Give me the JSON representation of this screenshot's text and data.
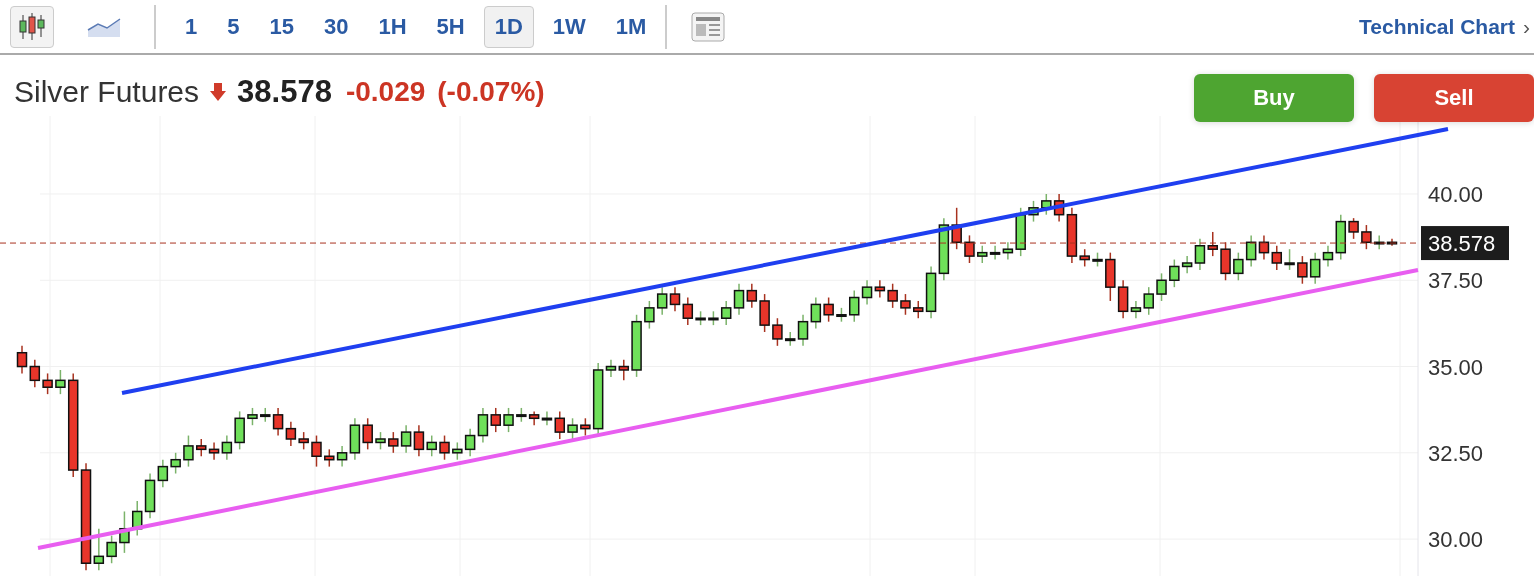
{
  "toolbar": {
    "chart_types": [
      {
        "kind": "candlestick",
        "selected": true
      },
      {
        "kind": "area",
        "selected": false
      }
    ],
    "intervals": [
      {
        "label": "1",
        "selected": false
      },
      {
        "label": "5",
        "selected": false
      },
      {
        "label": "15",
        "selected": false
      },
      {
        "label": "30",
        "selected": false
      },
      {
        "label": "1H",
        "selected": false
      },
      {
        "label": "5H",
        "selected": false
      },
      {
        "label": "1D",
        "selected": true
      },
      {
        "label": "1W",
        "selected": false
      },
      {
        "label": "1M",
        "selected": false
      }
    ],
    "link": {
      "label": "Technical Chart",
      "chevron": "›"
    }
  },
  "quote": {
    "name": "Silver Futures",
    "falling": true,
    "price": "38.578",
    "change": "-0.029",
    "change_percent": "(-0.07%)"
  },
  "actions": [
    {
      "kind": "buy",
      "label": "Buy"
    },
    {
      "kind": "sell",
      "label": "Sell"
    }
  ],
  "chart": {
    "chart_data": {
      "type": "candlestick",
      "grid": true,
      "ylim": [
        28.93,
        42.26
      ],
      "ref_lines": [
        {
          "axis": "y",
          "value": 38.578,
          "label": "38.578"
        }
      ],
      "yticks": [
        {
          "value": 40,
          "label": "40.00"
        },
        {
          "value": 37.5,
          "label": "37.50"
        },
        {
          "value": 35,
          "label": "35.00"
        },
        {
          "value": 32.5,
          "label": "32.50"
        },
        {
          "value": 30,
          "label": "30.00"
        }
      ],
      "categories": [
        null,
        null,
        null,
        null,
        null,
        null,
        null,
        null,
        null,
        null,
        null,
        null,
        null,
        null,
        null,
        null,
        null,
        null,
        null,
        null,
        null,
        null,
        null,
        null,
        null,
        null,
        null,
        null,
        null,
        null,
        null,
        null,
        null,
        null,
        null,
        null,
        null,
        null,
        null,
        null,
        null,
        null,
        null,
        null,
        null,
        null,
        null,
        null,
        null,
        null,
        null,
        null,
        null,
        null,
        null,
        null,
        null,
        null,
        null,
        null,
        null,
        null,
        null,
        null,
        null,
        null,
        null,
        null,
        null,
        null,
        null,
        null,
        null,
        null,
        null,
        null,
        null,
        null,
        null,
        null,
        null,
        null,
        null,
        null,
        null,
        null,
        null,
        null,
        null,
        null,
        null,
        null,
        null,
        null,
        null,
        null,
        null,
        null,
        null,
        null,
        null,
        null,
        null,
        null,
        null,
        null,
        null,
        null
      ],
      "ohlc": [
        [
          35.4,
          35.6,
          34.8,
          35.0
        ],
        [
          35.0,
          35.2,
          34.4,
          34.6
        ],
        [
          34.6,
          34.8,
          34.2,
          34.4
        ],
        [
          34.4,
          34.9,
          34.2,
          34.6
        ],
        [
          34.6,
          34.8,
          31.8,
          32.0
        ],
        [
          32.0,
          32.2,
          29.1,
          29.3
        ],
        [
          29.3,
          30.3,
          29.1,
          29.5
        ],
        [
          29.5,
          30.1,
          29.3,
          29.9
        ],
        [
          29.9,
          30.8,
          29.6,
          30.3
        ],
        [
          30.3,
          31.1,
          30.1,
          30.8
        ],
        [
          30.8,
          31.9,
          30.6,
          31.7
        ],
        [
          31.7,
          32.3,
          31.5,
          32.1
        ],
        [
          32.1,
          32.5,
          31.9,
          32.3
        ],
        [
          32.3,
          33.0,
          32.1,
          32.7
        ],
        [
          32.7,
          32.9,
          32.4,
          32.6
        ],
        [
          32.6,
          32.8,
          32.3,
          32.5
        ],
        [
          32.5,
          33.0,
          32.3,
          32.8
        ],
        [
          32.8,
          33.7,
          32.6,
          33.5
        ],
        [
          33.5,
          33.8,
          33.3,
          33.6
        ],
        [
          33.6,
          33.8,
          33.4,
          33.6
        ],
        [
          33.6,
          33.8,
          33.0,
          33.2
        ],
        [
          33.2,
          33.4,
          32.7,
          32.9
        ],
        [
          32.9,
          33.1,
          32.6,
          32.8
        ],
        [
          32.8,
          33.0,
          32.1,
          32.4
        ],
        [
          32.4,
          32.6,
          32.1,
          32.3
        ],
        [
          32.3,
          32.7,
          32.1,
          32.5
        ],
        [
          32.5,
          33.5,
          32.3,
          33.3
        ],
        [
          33.3,
          33.5,
          32.6,
          32.8
        ],
        [
          32.8,
          33.1,
          32.6,
          32.9
        ],
        [
          32.9,
          33.1,
          32.5,
          32.7
        ],
        [
          32.7,
          33.3,
          32.5,
          33.1
        ],
        [
          33.1,
          33.3,
          32.4,
          32.6
        ],
        [
          32.6,
          33.0,
          32.4,
          32.8
        ],
        [
          32.8,
          33.0,
          32.3,
          32.5
        ],
        [
          32.5,
          32.8,
          32.3,
          32.6
        ],
        [
          32.6,
          33.2,
          32.4,
          33.0
        ],
        [
          33.0,
          33.8,
          32.8,
          33.6
        ],
        [
          33.6,
          33.8,
          33.1,
          33.3
        ],
        [
          33.3,
          33.8,
          33.1,
          33.6
        ],
        [
          33.6,
          33.8,
          33.4,
          33.6
        ],
        [
          33.6,
          33.7,
          33.3,
          33.5
        ],
        [
          33.5,
          33.7,
          33.3,
          33.5
        ],
        [
          33.5,
          33.7,
          32.9,
          33.1
        ],
        [
          33.1,
          33.5,
          32.9,
          33.3
        ],
        [
          33.3,
          33.5,
          33.0,
          33.2
        ],
        [
          33.2,
          35.1,
          33.0,
          34.9
        ],
        [
          34.9,
          35.2,
          34.7,
          35.0
        ],
        [
          35.0,
          35.2,
          34.6,
          34.9
        ],
        [
          34.9,
          36.5,
          34.7,
          36.3
        ],
        [
          36.3,
          36.9,
          36.1,
          36.7
        ],
        [
          36.7,
          37.3,
          36.5,
          37.1
        ],
        [
          37.1,
          37.3,
          36.6,
          36.8
        ],
        [
          36.8,
          37.0,
          36.2,
          36.4
        ],
        [
          36.4,
          36.6,
          36.2,
          36.4
        ],
        [
          36.4,
          36.6,
          36.2,
          36.4
        ],
        [
          36.4,
          36.9,
          36.2,
          36.7
        ],
        [
          36.7,
          37.4,
          36.5,
          37.2
        ],
        [
          37.2,
          37.4,
          36.7,
          36.9
        ],
        [
          36.9,
          37.1,
          36.0,
          36.2
        ],
        [
          36.2,
          36.4,
          35.6,
          35.8
        ],
        [
          35.8,
          36.0,
          35.6,
          35.8
        ],
        [
          35.8,
          36.5,
          35.6,
          36.3
        ],
        [
          36.3,
          37.0,
          36.1,
          36.8
        ],
        [
          36.8,
          37.0,
          36.3,
          36.5
        ],
        [
          36.5,
          36.7,
          36.3,
          36.5
        ],
        [
          36.5,
          37.2,
          36.3,
          37.0
        ],
        [
          37.0,
          37.5,
          36.8,
          37.3
        ],
        [
          37.3,
          37.5,
          37.0,
          37.2
        ],
        [
          37.2,
          37.4,
          36.7,
          36.9
        ],
        [
          36.9,
          37.1,
          36.5,
          36.7
        ],
        [
          36.7,
          36.9,
          36.4,
          36.6
        ],
        [
          36.6,
          37.9,
          36.4,
          37.7
        ],
        [
          37.7,
          39.3,
          37.5,
          39.1
        ],
        [
          39.1,
          39.6,
          38.4,
          38.6
        ],
        [
          38.6,
          38.8,
          38.0,
          38.2
        ],
        [
          38.2,
          38.5,
          38.0,
          38.3
        ],
        [
          38.3,
          38.5,
          38.1,
          38.3
        ],
        [
          38.3,
          38.6,
          38.1,
          38.4
        ],
        [
          38.4,
          39.6,
          38.2,
          39.4
        ],
        [
          39.4,
          39.8,
          39.2,
          39.6
        ],
        [
          39.6,
          40.0,
          39.4,
          39.8
        ],
        [
          39.8,
          40.0,
          39.2,
          39.4
        ],
        [
          39.4,
          39.6,
          38.0,
          38.2
        ],
        [
          38.2,
          38.4,
          37.9,
          38.1
        ],
        [
          38.1,
          38.3,
          37.9,
          38.1
        ],
        [
          38.1,
          38.3,
          36.9,
          37.3
        ],
        [
          37.3,
          37.5,
          36.4,
          36.6
        ],
        [
          36.6,
          36.9,
          36.4,
          36.7
        ],
        [
          36.7,
          37.3,
          36.5,
          37.1
        ],
        [
          37.1,
          37.7,
          36.9,
          37.5
        ],
        [
          37.5,
          38.1,
          37.3,
          37.9
        ],
        [
          37.9,
          38.2,
          37.7,
          38.0
        ],
        [
          38.0,
          38.7,
          37.8,
          38.5
        ],
        [
          38.5,
          38.9,
          38.2,
          38.4
        ],
        [
          38.4,
          38.6,
          37.5,
          37.7
        ],
        [
          37.7,
          38.3,
          37.5,
          38.1
        ],
        [
          38.1,
          38.8,
          37.9,
          38.6
        ],
        [
          38.6,
          38.8,
          38.1,
          38.3
        ],
        [
          38.3,
          38.5,
          37.8,
          38.0
        ],
        [
          38.0,
          38.4,
          37.8,
          38.0
        ],
        [
          38.0,
          38.2,
          37.4,
          37.6
        ],
        [
          37.6,
          38.3,
          37.4,
          38.1
        ],
        [
          38.1,
          38.5,
          37.9,
          38.3
        ],
        [
          38.3,
          39.4,
          38.1,
          39.2
        ],
        [
          39.2,
          39.3,
          38.7,
          38.9
        ],
        [
          38.9,
          39.1,
          38.4,
          38.6
        ],
        [
          38.6,
          38.8,
          38.4,
          38.6
        ],
        [
          38.6,
          38.7,
          38.5,
          38.578
        ]
      ]
    }
  }
}
